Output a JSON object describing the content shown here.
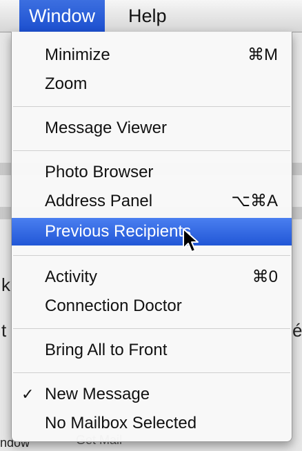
{
  "menubar": {
    "items": [
      {
        "label": "Window",
        "active": true
      },
      {
        "label": "Help",
        "active": false
      }
    ]
  },
  "menu": {
    "groups": [
      [
        {
          "label": "Minimize",
          "shortcut": "⌘M"
        },
        {
          "label": "Zoom",
          "shortcut": ""
        }
      ],
      [
        {
          "label": "Message Viewer",
          "shortcut": ""
        }
      ],
      [
        {
          "label": "Photo Browser",
          "shortcut": ""
        },
        {
          "label": "Address Panel",
          "shortcut": "⌥⌘A"
        },
        {
          "label": "Previous Recipients",
          "shortcut": "",
          "highlighted": true
        }
      ],
      [
        {
          "label": "Activity",
          "shortcut": "⌘0"
        },
        {
          "label": "Connection Doctor",
          "shortcut": ""
        }
      ],
      [
        {
          "label": "Bring All to Front",
          "shortcut": ""
        }
      ],
      [
        {
          "label": "New Message",
          "shortcut": "",
          "checked": true
        },
        {
          "label": "No Mailbox Selected",
          "shortcut": ""
        }
      ]
    ],
    "check_glyph": "✓"
  },
  "background": {
    "fragments": [
      "k",
      "t",
      "é",
      "Get Mail",
      "ndow"
    ]
  },
  "colors": {
    "highlight": "#2157d6",
    "menu_bg": "#f8f8f8"
  }
}
